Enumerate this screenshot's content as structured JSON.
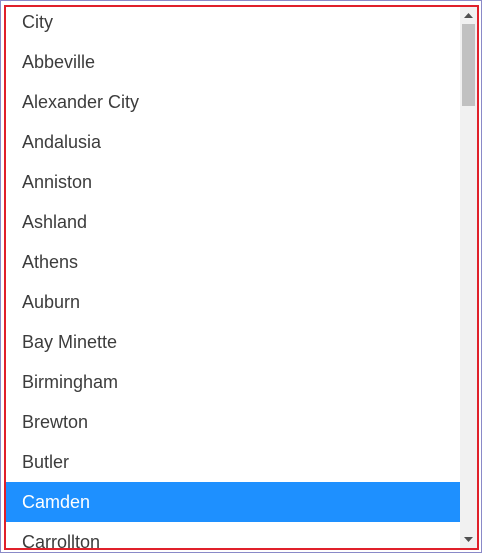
{
  "select": {
    "options": [
      "City",
      "Abbeville",
      "Alexander City",
      "Andalusia",
      "Anniston",
      "Ashland",
      "Athens",
      "Auburn",
      "Bay Minette",
      "Birmingham",
      "Brewton",
      "Butler",
      "Camden",
      "Carrollton"
    ],
    "selected": "Camden",
    "selected_index": 12
  },
  "colors": {
    "selected_bg": "#1e90ff",
    "selected_text": "#ffffff",
    "option_text": "#3c3c3c",
    "frame_border": "#e0202a",
    "outer_border": "#8a8ac8"
  },
  "scrollbar": {
    "position_fraction": 0.0,
    "visible_fraction": 0.15
  },
  "icons": {
    "scroll_up": "scroll-up-arrow-icon",
    "scroll_down": "scroll-down-arrow-icon"
  }
}
